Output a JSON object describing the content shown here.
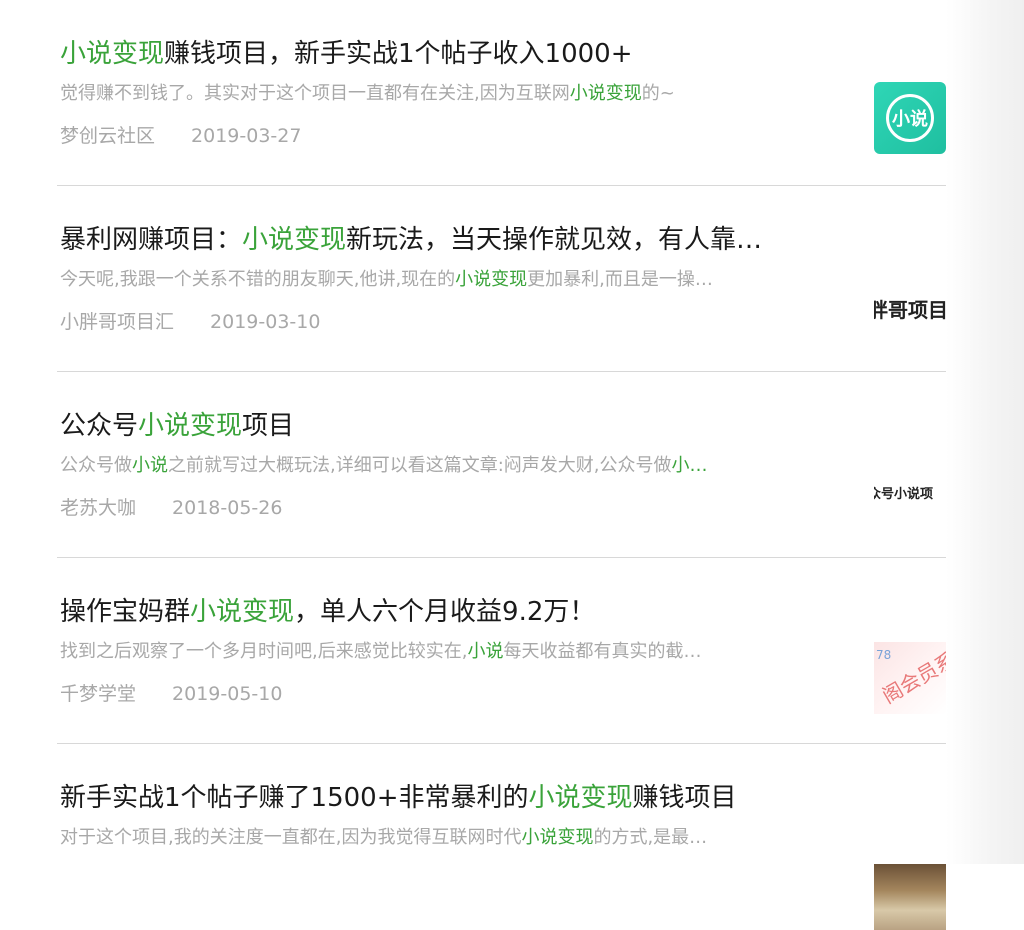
{
  "items": [
    {
      "title": [
        {
          "t": "小说变现",
          "h": true
        },
        {
          "t": "赚钱项目，新手实战1个帖子收入1000+",
          "h": false
        }
      ],
      "snippet": [
        {
          "t": "觉得赚不到钱了。其实对于这个项目一直都有在关注,因为互联网",
          "h": false
        },
        {
          "t": "小说变现",
          "h": true
        },
        {
          "t": "的~",
          "h": false
        }
      ],
      "source": "梦创云社区",
      "date": "2019-03-27",
      "thumb": {
        "kind": "app",
        "text": "小说"
      }
    },
    {
      "title": [
        {
          "t": "暴利网赚项目：",
          "h": false
        },
        {
          "t": "小说变现",
          "h": true
        },
        {
          "t": "新玩法，当天操作就见效，有人靠…",
          "h": false
        }
      ],
      "snippet": [
        {
          "t": "今天呢,我跟一个关系不错的朋友聊天,他讲,现在的",
          "h": false
        },
        {
          "t": "小说变现",
          "h": true
        },
        {
          "t": "更加暴利,而且是一操…",
          "h": false
        }
      ],
      "source": "小胖哥项目汇",
      "date": "2019-03-10",
      "thumb": {
        "kind": "text",
        "text": "胖哥项目"
      }
    },
    {
      "title": [
        {
          "t": "公众号",
          "h": false
        },
        {
          "t": "小说变现",
          "h": true
        },
        {
          "t": "项目",
          "h": false
        }
      ],
      "snippet": [
        {
          "t": "公众号做",
          "h": false
        },
        {
          "t": "小说",
          "h": true
        },
        {
          "t": "之前就写过大概玩法,详细可以看这篇文章:闷声发大财,公众号做",
          "h": false
        },
        {
          "t": "小…",
          "h": true
        }
      ],
      "source": "老苏大咖",
      "date": "2018-05-26",
      "thumb": {
        "kind": "text-small",
        "text": "众号小说项"
      }
    },
    {
      "title": [
        {
          "t": "操作宝妈群",
          "h": false
        },
        {
          "t": "小说变现",
          "h": true
        },
        {
          "t": "，单人六个月收益9.2万！",
          "h": false
        }
      ],
      "snippet": [
        {
          "t": "找到之后观察了一个多月时间吧,后来感觉比较实在,",
          "h": false
        },
        {
          "t": "小说",
          "h": true
        },
        {
          "t": "每天收益都有真实的截…",
          "h": false
        }
      ],
      "source": "千梦学堂",
      "date": "2019-05-10",
      "thumb": {
        "kind": "stamp",
        "num": "78",
        "text": "阁会员系"
      }
    },
    {
      "title": [
        {
          "t": "新手实战1个帖子赚了1500+非常暴利的",
          "h": false
        },
        {
          "t": "小说变现",
          "h": true
        },
        {
          "t": "赚钱项目",
          "h": false
        }
      ],
      "snippet": [
        {
          "t": "对于这个项目,我的关注度一直都在,因为我觉得互联网时代",
          "h": false
        },
        {
          "t": "小说变现",
          "h": true
        },
        {
          "t": "的方式,是最…",
          "h": false
        }
      ],
      "source": "",
      "date": "",
      "thumb": {
        "kind": "photo"
      }
    }
  ],
  "colors": {
    "highlight": "#3aa33a",
    "title": "#1a1a1a",
    "muted": "#a8a8a8",
    "divider": "#d8d8d8"
  }
}
